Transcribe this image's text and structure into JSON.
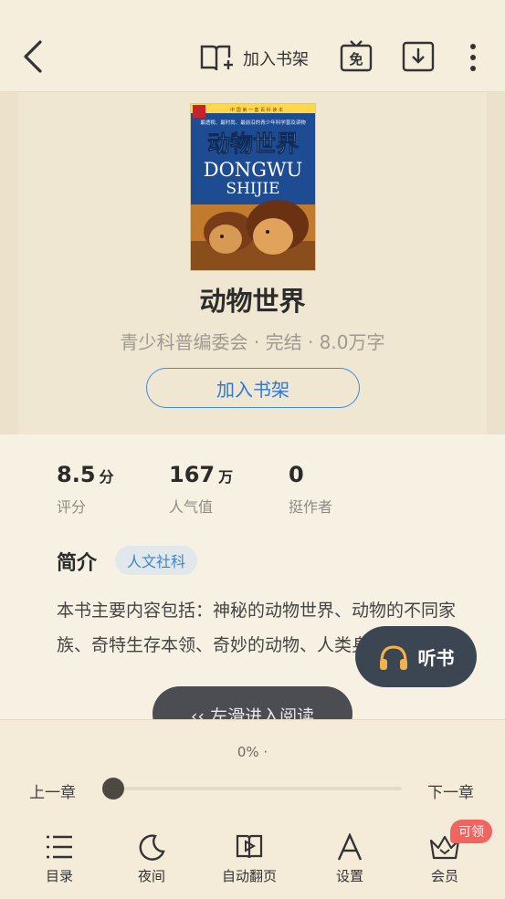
{
  "header": {
    "add_shelf_label": "加入书架",
    "free_label": "免"
  },
  "book": {
    "title": "动物世界",
    "meta": "青少科普编委会 · 完结 · 8.0万字",
    "add_button_label": "加入书架",
    "cover": {
      "top_line": "中 国 第 一 套 百 科 读 本",
      "blurb": "最透视、最时尚、最前沿的青少年科学普及读物",
      "title_cn": "动物世界",
      "pinyin_1": "DONGWU",
      "pinyin_2": "SHIJIE"
    }
  },
  "stats": [
    {
      "value": "8.5",
      "unit": "分",
      "label": "评分"
    },
    {
      "value": "167",
      "unit": "万",
      "label": "人气值"
    },
    {
      "value": "0",
      "unit": "",
      "label": "挺作者"
    }
  ],
  "intro": {
    "heading": "简介",
    "tag": "人文社科",
    "description": "本书主要内容包括：神秘的动物世界、动物的不同家族、奇特生存本领、奇妙的动物、人类身边的动物。"
  },
  "listen_label": "听书",
  "swipe_hint": "‹‹ 左滑进入阅读",
  "reader": {
    "progress_text": "0% ·",
    "progress": 0,
    "prev_label": "上一章",
    "next_label": "下一章"
  },
  "bottom_nav": [
    {
      "label": "目录",
      "icon": "menu-list-icon"
    },
    {
      "label": "夜间",
      "icon": "moon-icon"
    },
    {
      "label": "自动翻页",
      "icon": "play-page-icon"
    },
    {
      "label": "设置",
      "icon": "font-a-icon"
    },
    {
      "label": "会员",
      "icon": "crown-icon"
    }
  ],
  "vip_badge": "可领",
  "colors": {
    "background": "#f5eedc",
    "accent_blue": "#2c7ad9",
    "badge_red": "#f0655f",
    "float_dark": "#3c4652"
  }
}
